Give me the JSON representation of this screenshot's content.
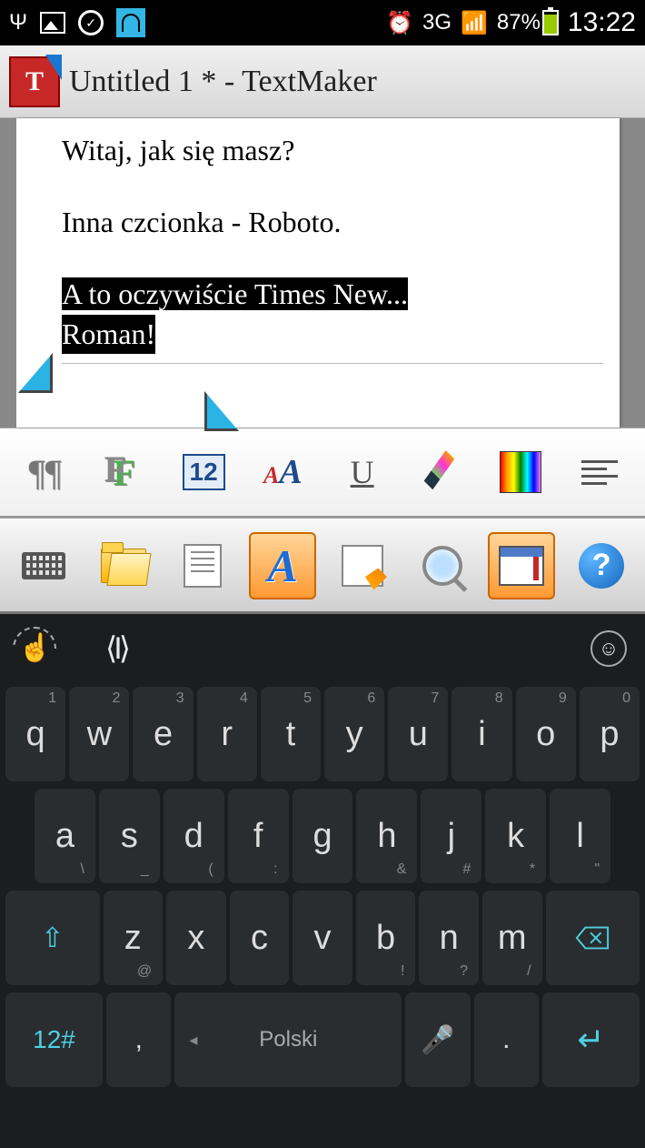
{
  "status": {
    "battery_pct": "87%",
    "time": "13:22",
    "network": "3G"
  },
  "title": {
    "text": "Untitled 1 * - TextMaker"
  },
  "document": {
    "line1": "Witaj, jak się masz?",
    "line2": "Inna czcionka - Roboto.",
    "selection_line1": "A to oczywiście Times New...",
    "selection_line2": "Roman!"
  },
  "format_toolbar": {
    "font_size": "12"
  },
  "keyboard": {
    "language": "Polski",
    "mode_key": "12#",
    "row1": [
      {
        "k": "q",
        "n": "1"
      },
      {
        "k": "w",
        "n": "2"
      },
      {
        "k": "e",
        "n": "3"
      },
      {
        "k": "r",
        "n": "4"
      },
      {
        "k": "t",
        "n": "5"
      },
      {
        "k": "y",
        "n": "6"
      },
      {
        "k": "u",
        "n": "7"
      },
      {
        "k": "i",
        "n": "8"
      },
      {
        "k": "o",
        "n": "9"
      },
      {
        "k": "p",
        "n": "0"
      }
    ],
    "row2": [
      {
        "k": "a",
        "s": "\\"
      },
      {
        "k": "s",
        "s": "_"
      },
      {
        "k": "d",
        "s": "("
      },
      {
        "k": "f",
        "s": ":"
      },
      {
        "k": "g",
        "s": ""
      },
      {
        "k": "h",
        "s": "&"
      },
      {
        "k": "j",
        "s": "#"
      },
      {
        "k": "k",
        "s": "*"
      },
      {
        "k": "l",
        "s": "\""
      }
    ],
    "row3": [
      {
        "k": "z",
        "s": "@"
      },
      {
        "k": "x",
        "s": ""
      },
      {
        "k": "c",
        "s": ""
      },
      {
        "k": "v",
        "s": ""
      },
      {
        "k": "b",
        "s": "!"
      },
      {
        "k": "n",
        "s": "?"
      },
      {
        "k": "m",
        "s": "/"
      }
    ]
  }
}
